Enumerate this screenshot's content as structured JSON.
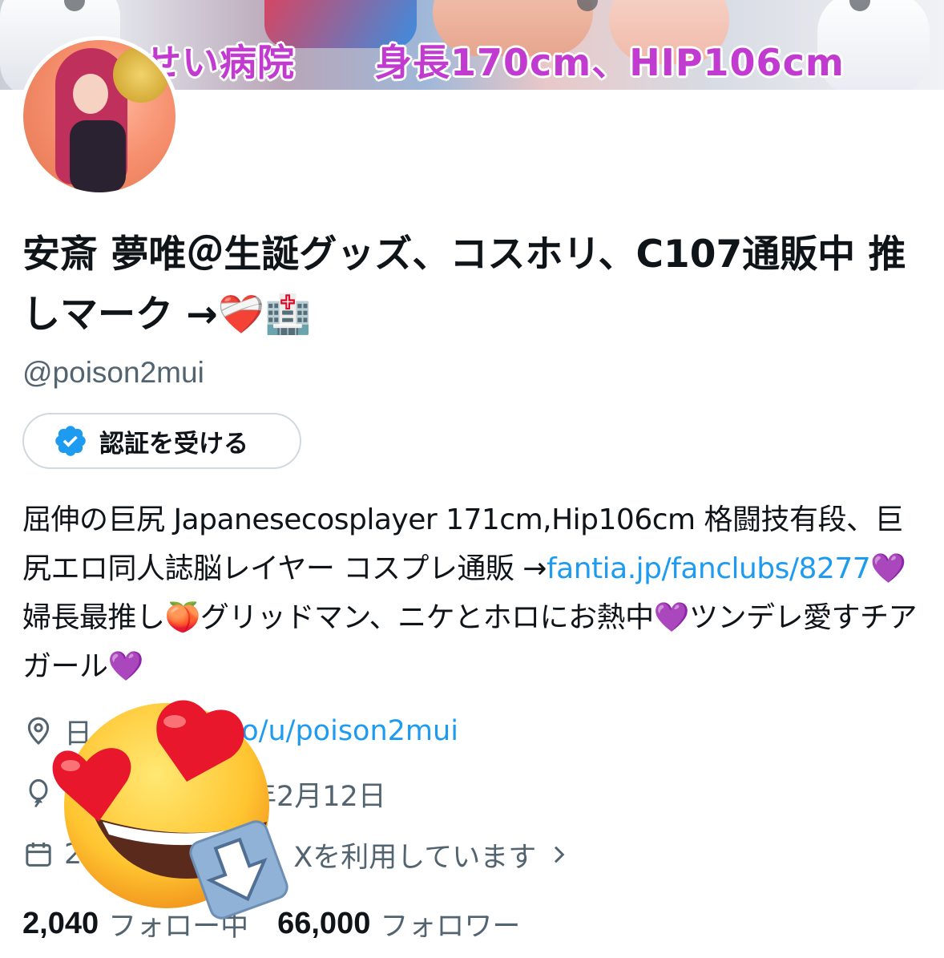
{
  "banner": {
    "caption_left": "せい病院",
    "caption_right": "身長170cm、HIP106cm"
  },
  "profile": {
    "display_name": "安斎 夢唯＠生誕グッズ、コスホリ、C107通販中 推しマーク →❤️‍🩹🏥",
    "handle": "@poison2mui",
    "verify_button": "認証を受ける",
    "bio": {
      "part1": "屈伸の巨尻 Japanesecosplayer 171cm,Hip106cm 格闘技有段、巨尻エロ同人誌脳レイヤー コスプレ通販 →",
      "link": "fantia.jp/fanclubs/8277",
      "part2": "💜婦長最推し🍑グリッドマン、ニケとホロにお熱中💜ツンデレ愛すチアガール💜"
    },
    "location_visible": "日",
    "website_visible": "nt.co/u/poison2mui",
    "birthday_visible": "年2月12日",
    "joined_visible_prefix": "2",
    "joined_visible_suffix": "Xを利用しています",
    "following_count": "2,040",
    "following_label": "フォロー中",
    "followers_count": "66,000",
    "followers_label": "フォロワー"
  },
  "colors": {
    "accent": "#1d9bf0",
    "secondary_text": "#536471",
    "banner_caption": "#c23bd0"
  },
  "icons": [
    "verified-badge-icon",
    "location-pin-icon",
    "balloon-icon",
    "calendar-icon",
    "chevron-right-icon",
    "heart-eyes-emoji-sticker",
    "download-arrow-icon"
  ]
}
